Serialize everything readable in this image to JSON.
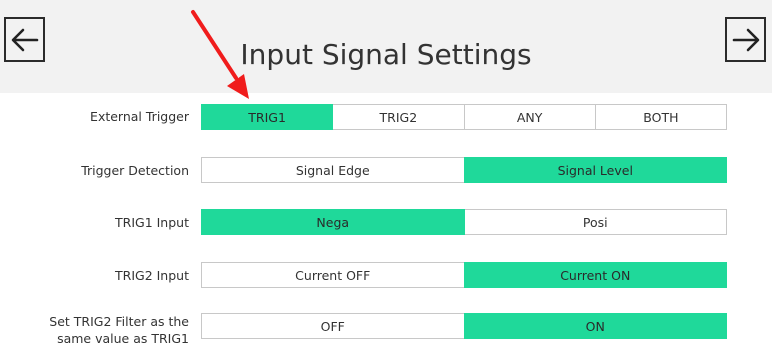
{
  "header": {
    "title": "Input Signal Settings",
    "back_icon": "arrow-left-icon",
    "forward_icon": "arrow-right-icon"
  },
  "rows": [
    {
      "label": "External Trigger",
      "options": [
        "TRIG1",
        "TRIG2",
        "ANY",
        "BOTH"
      ],
      "selected": "TRIG1"
    },
    {
      "label": "Trigger Detection",
      "options": [
        "Signal Edge",
        "Signal Level"
      ],
      "selected": "Signal Level"
    },
    {
      "label": "TRIG1 Input",
      "options": [
        "Nega",
        "Posi"
      ],
      "selected": "Nega"
    },
    {
      "label": "TRIG2 Input",
      "options": [
        "Current OFF",
        "Current ON"
      ],
      "selected": "Current ON"
    },
    {
      "label_line1": "Set TRIG2 Filter as the",
      "label_line2": "same value as TRIG1",
      "options": [
        "OFF",
        "ON"
      ],
      "selected": "ON"
    }
  ],
  "colors": {
    "selected": "#1fd99a",
    "header_bg": "#f2f2f2",
    "annotation_arrow": "#f01c1c"
  },
  "annotation": {
    "type": "red-pointer-arrow",
    "target": "TRIG1"
  }
}
